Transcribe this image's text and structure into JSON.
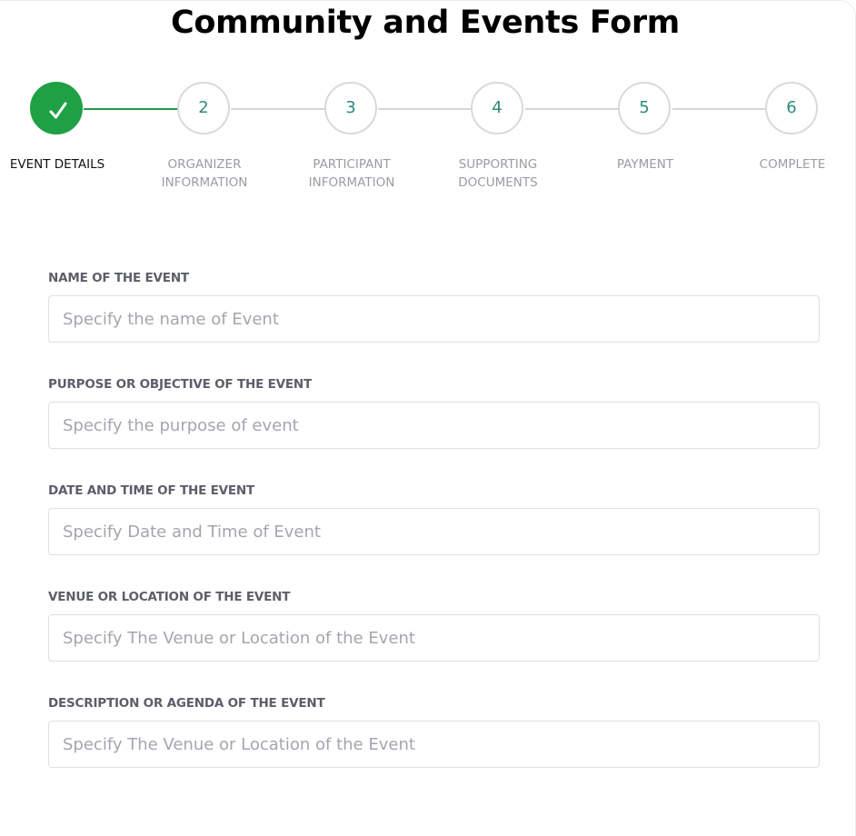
{
  "page": {
    "title": "Community and Events Form"
  },
  "stepper": {
    "accent_color": "#1fa044",
    "steps": [
      {
        "number": "",
        "icon": "check-icon",
        "label_line1": "EVENT DETAILS",
        "label_line2": "",
        "state": "completed"
      },
      {
        "number": "2",
        "label_line1": "ORGANIZER",
        "label_line2": "INFORMATION",
        "state": "pending"
      },
      {
        "number": "3",
        "label_line1": "PARTICIPANT",
        "label_line2": "INFORMATION",
        "state": "pending"
      },
      {
        "number": "4",
        "label_line1": "SUPPORTING",
        "label_line2": "DOCUMENTS",
        "state": "pending"
      },
      {
        "number": "5",
        "label_line1": "PAYMENT",
        "label_line2": "",
        "state": "pending"
      },
      {
        "number": "6",
        "label_line1": "COMPLETE",
        "label_line2": "",
        "state": "pending"
      }
    ]
  },
  "form": {
    "fields": [
      {
        "label": "NAME OF THE EVENT",
        "value": "",
        "placeholder": "Specify the name of Event"
      },
      {
        "label": "PURPOSE OR OBJECTIVE OF THE EVENT",
        "value": "",
        "placeholder": "Specify the purpose of event"
      },
      {
        "label": "DATE AND TIME OF THE EVENT",
        "value": "",
        "placeholder": "Specify Date and Time of Event"
      },
      {
        "label": "VENUE OR LOCATION OF THE EVENT",
        "value": "",
        "placeholder": "Specify The Venue or Location of the Event"
      },
      {
        "label": "DESCRIPTION OR AGENDA OF THE EVENT",
        "value": "",
        "placeholder": "Specify The Venue or Location of the Event"
      }
    ]
  }
}
